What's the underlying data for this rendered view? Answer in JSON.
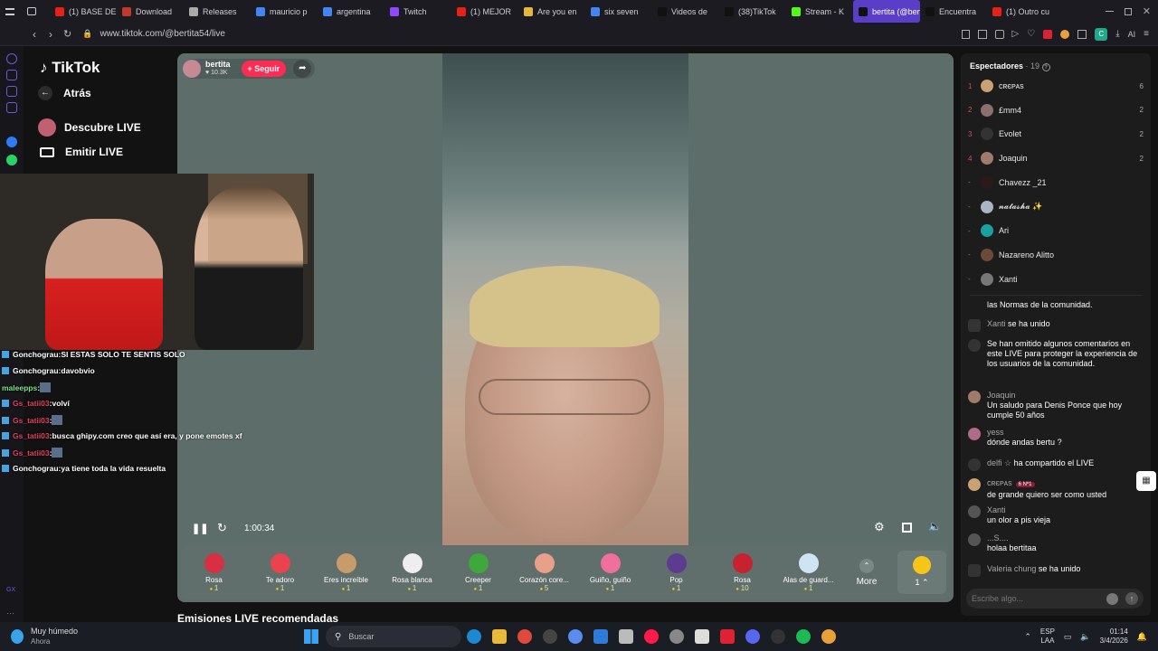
{
  "browser": {
    "tabs": [
      {
        "label": "(1) BASE DE",
        "color": "#e62117"
      },
      {
        "label": "Download",
        "color": "#c0392b"
      },
      {
        "label": "Releases",
        "color": "#aaa"
      },
      {
        "label": "mauricio p",
        "color": "#4285f4"
      },
      {
        "label": "argentina",
        "color": "#4285f4"
      },
      {
        "label": "Twitch",
        "color": "#9146ff"
      },
      {
        "label": "(1) MEJOR",
        "color": "#e62117"
      },
      {
        "label": "Are you en",
        "color": "#e7b53b"
      },
      {
        "label": "six seven",
        "color": "#4285f4"
      },
      {
        "label": "Videos de",
        "color": "#111"
      },
      {
        "label": "(38)TikTok",
        "color": "#111"
      },
      {
        "label": "Stream - K",
        "color": "#53fc18"
      },
      {
        "label": "bertita (@bertita",
        "color": "#111"
      },
      {
        "label": "Encuentra",
        "color": "#111"
      },
      {
        "label": "(1) Outro cu",
        "color": "#e62117"
      }
    ],
    "url": "www.tiktok.com/@bertita54/live"
  },
  "nav": {
    "logo": "TikTok",
    "back": "Atrás",
    "items": [
      {
        "label": "Descubre LIVE"
      },
      {
        "label": "Emitir LIVE"
      }
    ]
  },
  "stream": {
    "host": "bertita",
    "likes": "10.3K",
    "follow": "+ Seguir",
    "time": "1:00:34"
  },
  "gifts": [
    {
      "name": "Rosa",
      "cost": "1",
      "color": "#d63042"
    },
    {
      "name": "Te adoro",
      "cost": "1",
      "color": "#e8434f"
    },
    {
      "name": "Eres increíble",
      "cost": "1",
      "color": "#c79b6a"
    },
    {
      "name": "Rosa blanca",
      "cost": "1",
      "color": "#eeeeee"
    },
    {
      "name": "Creeper",
      "cost": "1",
      "color": "#3fa83c"
    },
    {
      "name": "Corazón core...",
      "cost": "5",
      "color": "#e9a088"
    },
    {
      "name": "Guiño, guiño",
      "cost": "1",
      "color": "#ef6f9d"
    },
    {
      "name": "Pop",
      "cost": "1",
      "color": "#5b3c91"
    },
    {
      "name": "Rosa",
      "cost": "10",
      "color": "#c82130"
    },
    {
      "name": "Alas de guard...",
      "cost": "1",
      "color": "#cfe4f2"
    }
  ],
  "gift_more": "More",
  "coins": {
    "label": "1"
  },
  "viewers": {
    "title": "Espectadores",
    "count": "· 19",
    "list": [
      {
        "rank": "1",
        "name": "ᴄʀєᴘᴀѕ",
        "count": "6",
        "color": "#c9a172"
      },
      {
        "rank": "2",
        "name": "£mm4",
        "count": "2",
        "color": "#8c6f6f"
      },
      {
        "rank": "3",
        "name": "Evolet",
        "count": "2",
        "color": "#333"
      },
      {
        "rank": "4",
        "name": "Joaquin",
        "count": "2",
        "color": "#a07a6a"
      },
      {
        "rank": "-",
        "name": "Chavezz _21",
        "count": "",
        "color": "#2b1a1a"
      },
      {
        "rank": "-",
        "name": "𝓷𝓪𝓽𝓪𝓼𝓱𝓪 ✨",
        "count": "",
        "color": "#aab4c2"
      },
      {
        "rank": "-",
        "name": "Ari",
        "count": "",
        "color": "#1aa0a0"
      },
      {
        "rank": "-",
        "name": "Nazareno Alitto",
        "count": "",
        "color": "#6b4a3a"
      },
      {
        "rank": "-",
        "name": "Xanti",
        "count": "",
        "color": "#777"
      }
    ]
  },
  "comments": [
    {
      "name": "",
      "text": "las Normas de la comunidad."
    },
    {
      "name": "Xanti",
      "text": "se ha unido"
    },
    {
      "name": "",
      "text": "Se han omitido algunos comentarios en este LIVE para proteger la experiencia de los usuarios de la comunidad."
    },
    {
      "name": "Joaquin",
      "text": "Un saludo para Denis Ponce que hoy cumple 50 años"
    },
    {
      "name": "yess",
      "text": "dónde andas bertu ?"
    },
    {
      "name": "delfi ☆",
      "text": "ha compartido el LIVE"
    },
    {
      "name": "ᴄʀєᴘᴀѕ",
      "text": "de grande quiero ser como usted",
      "badge": "6 Nº1"
    },
    {
      "name": "Xanti",
      "text": "un olor a pis vieja"
    },
    {
      "name": "...S....",
      "text": "holaa bertitaa"
    },
    {
      "name": "Valeria chung",
      "text": "se ha unido"
    }
  ],
  "comment_placeholder": "Escribe algo...",
  "chat_overlay": [
    {
      "user": "Gonchograu",
      "text": "SI ESTAS SOLO TE SENTIS SOLO",
      "color": "#ffffff"
    },
    {
      "user": "Gonchograu",
      "text": "davobvio",
      "color": "#ffffff"
    },
    {
      "user": "maleepps",
      "text": "",
      "color": "#7ee08a"
    },
    {
      "user": "Gs_tatii03",
      "text": "volví",
      "color": "#e04060"
    },
    {
      "user": "Gs_tatii03",
      "text": "",
      "color": "#e04060"
    },
    {
      "user": "Gs_tatii03",
      "text": "busca ghipy.com creo que así era, y pone emotes xf",
      "color": "#e04060"
    },
    {
      "user": "Gs_tatii03",
      "text": "",
      "color": "#e04060"
    },
    {
      "user": "Gonchograu",
      "text": "ya tiene toda la vida resuelta",
      "color": "#ffffff"
    }
  ],
  "below_text": "Emisiones LIVE recomendadas",
  "taskbar": {
    "weather": "Muy húmedo",
    "weather_sub": "Ahora",
    "search": "Buscar",
    "lang": "ESP",
    "lang2": "LAA",
    "time": "01:14",
    "date": "3/4/2026"
  }
}
